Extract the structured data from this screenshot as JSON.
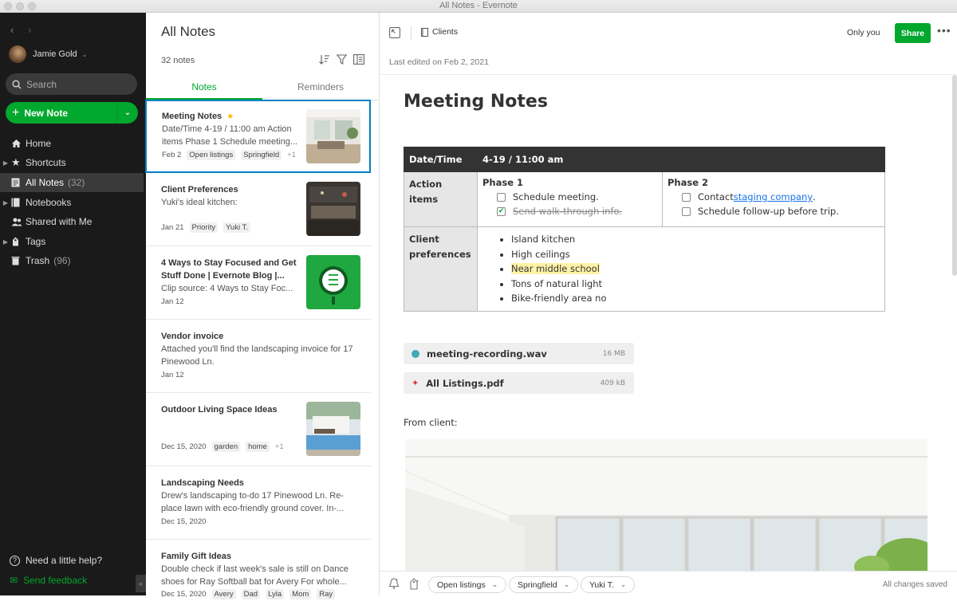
{
  "window": {
    "title": "All Notes - Evernote"
  },
  "sidebar": {
    "account_name": "Jamie Gold",
    "search_placeholder": "Search",
    "new_note_label": "New Note",
    "items": [
      {
        "label": "Home",
        "count": ""
      },
      {
        "label": "Shortcuts",
        "count": ""
      },
      {
        "label": "All Notes",
        "count": "(32)"
      },
      {
        "label": "Notebooks",
        "count": ""
      },
      {
        "label": "Shared with Me",
        "count": ""
      },
      {
        "label": "Tags",
        "count": ""
      },
      {
        "label": "Trash",
        "count": "(96)"
      }
    ],
    "help_label": "Need a little help?",
    "feedback_label": "Send feedback"
  },
  "note_list": {
    "title": "All Notes",
    "count": "32 notes",
    "tabs": [
      "Notes",
      "Reminders"
    ],
    "notes": [
      {
        "title": "Meeting Notes",
        "snippet": "Date/Time 4-19 / 11:00 am Action items Phase 1 Schedule meeting...",
        "date": "Feb 2",
        "tags": [
          "Open listings",
          "Springfield"
        ],
        "more": "+1"
      },
      {
        "title": "Client Preferences",
        "snippet": "Yuki's ideal kitchen:",
        "date": "Jan 21",
        "tags": [
          "Priority",
          "Yuki T."
        ],
        "more": ""
      },
      {
        "title": "4 Ways to Stay Focused and Get Stuff Done | Evernote Blog |...",
        "snippet": "Clip source: 4 Ways to Stay Foc...",
        "date": "Jan 12",
        "tags": [],
        "more": ""
      },
      {
        "title": "Vendor invoice",
        "snippet": "Attached you'll find the landscaping invoice for 17 Pinewood Ln.",
        "date": "Jan 12",
        "tags": [],
        "more": ""
      },
      {
        "title": "Outdoor Living Space Ideas",
        "snippet": "",
        "date": "Dec 15, 2020",
        "tags": [
          "garden",
          "home"
        ],
        "more": "+1"
      },
      {
        "title": "Landscaping Needs",
        "snippet": "Drew's landscaping to-do 17 Pinewood Ln. Re-place lawn with eco-friendly ground cover. In-...",
        "date": "Dec 15, 2020",
        "tags": [],
        "more": ""
      },
      {
        "title": "Family Gift Ideas",
        "snippet": "Double check if last week's sale is still on Dance shoes for Ray Softball bat for Avery For whole...",
        "date": "Dec 15, 2020",
        "tags": [
          "Avery",
          "Dad",
          "Lyla",
          "Mom",
          "Ray"
        ],
        "more": ""
      }
    ]
  },
  "editor": {
    "notebook": "Clients",
    "share_scope": "Only you",
    "share_label": "Share",
    "last_edited": "Last edited on Feb 2, 2021",
    "title": "Meeting Notes",
    "table": {
      "header": [
        "Date/Time",
        "4-19 / 11:00 am"
      ],
      "action_label": "Action items",
      "phase1_title": "Phase 1",
      "phase1_items": [
        {
          "text": "Schedule meeting.",
          "done": false
        },
        {
          "text": "Send walk-through info.",
          "done": true
        }
      ],
      "phase2_title": "Phase 2",
      "phase2_item1_prefix": "Contact ",
      "phase2_item1_link": "staging company",
      "phase2_item1_suffix": ".",
      "phase2_item2": "Schedule follow-up before trip.",
      "pref_label": "Client preferences",
      "prefs": [
        "Island kitchen",
        "High ceilings",
        "Near middle school",
        "Tons of natural light",
        "Bike-friendly area no"
      ]
    },
    "attachments": [
      {
        "name": "meeting-recording.wav",
        "size": "16 MB"
      },
      {
        "name": "All Listings.pdf",
        "size": "409 kB"
      }
    ],
    "from_client": "From client:",
    "footer_tags": [
      "Open listings",
      "Springfield",
      "Yuki T."
    ],
    "save_status": "All changes saved"
  },
  "colors": {
    "accent": "#00a82d",
    "sidebar_bg": "#1a1a1a",
    "selection": "#0081c2"
  }
}
